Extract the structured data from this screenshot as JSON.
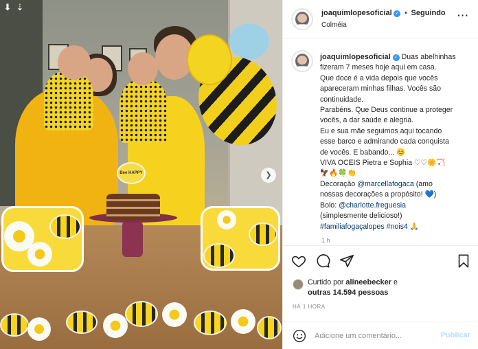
{
  "post": {
    "username": "joaquimlopesoficial",
    "follow_status": "Seguindo",
    "location": "Colméia",
    "caption_lines": [
      "Duas abelhinhas",
      "fizeram 7 meses hoje aqui em casa.",
      "Que doce é a vida depois que vocês",
      "apareceram minhas filhas. Vocês são",
      "continuidade.",
      "Parabéns. Que Deus continue a proteger",
      "vocês, a dar saúde e alegria.",
      "Eu e sua mãe seguimos aqui tocando",
      "esse barco e admirando cada conquista",
      "de vocês. E babando... 😊",
      "VIVA OCEIS Pietra e Sophia ♡♡🌼🏹",
      "🦅🔥🍀👏"
    ],
    "decoration_prefix": "Decoração ",
    "decoration_mention": "@marcellafogaca",
    "decoration_suffix": " (amo",
    "decoration_line2": "nossas decorações a propósito! 💙)",
    "cake_prefix": "Bolo: ",
    "cake_mention": "@charlotte.freguesia",
    "cake_line2": "(simplesmente delicioso!)",
    "hashtag_1": "#familiafogaçalopes",
    "hashtag_2": "#nois4",
    "hashtag_emoji": "🙏",
    "caption_time": "1 h"
  },
  "likes": {
    "prefix": "Curtido por ",
    "first_user": "alineebecker",
    "middle": " e",
    "others": "outras 14.594 pessoas"
  },
  "posted_ago": "HÁ 1 HORA",
  "comment": {
    "placeholder": "Adicione um comentário...",
    "publish_label": "Publicar"
  },
  "photo": {
    "topper_text": "Bee HAPPY"
  },
  "icons": {
    "verified": "verified-badge-icon",
    "more": "more-options-icon",
    "like": "heart-icon",
    "comment": "comment-bubble-icon",
    "share": "paper-plane-icon",
    "save": "bookmark-icon",
    "emoji": "smiley-icon",
    "next": "chevron-right-icon",
    "tag": "multiple-photos-icon"
  },
  "colors": {
    "accent": "#3897f0",
    "link": "#00376b",
    "publish_disabled": "#b2dffc",
    "muted": "#8e8e8e"
  }
}
